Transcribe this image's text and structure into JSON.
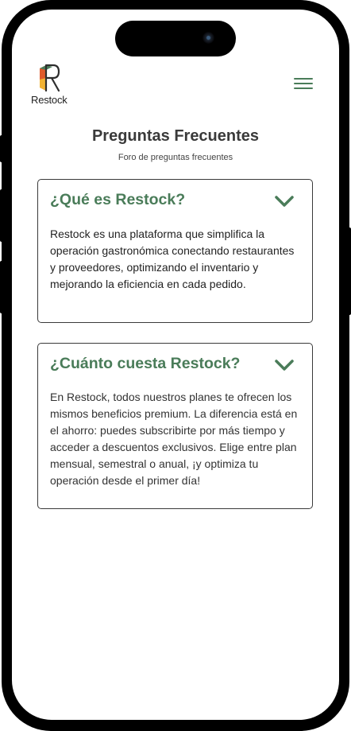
{
  "brand": {
    "name": "Restock",
    "colors": {
      "accent": "#4a7c59",
      "logo_green": "#4a7c59",
      "logo_orange": "#e05a2b",
      "logo_yellow": "#f2b233",
      "logo_dark": "#2e2e2e"
    }
  },
  "header": {
    "menu_icon": "hamburger-menu-icon"
  },
  "page": {
    "title": "Preguntas Frecuentes",
    "subtitle": "Foro de preguntas frecuentes"
  },
  "faq": [
    {
      "question": "¿Qué es Restock?",
      "answer": "Restock es una plataforma que simplifica la operación gastronómica conectando restaurantes y proveedores, optimizando el inventario y mejorando la eficiencia en cada pedido.",
      "icon": "chevron-down-icon"
    },
    {
      "question": "¿Cuánto cuesta Restock?",
      "answer": "En Restock, todos nuestros planes te ofrecen los mismos beneficios premium. La diferencia está en el ahorro: puedes subscribirte por más tiempo y acceder a descuentos exclusivos. Elige entre plan mensual, semestral o anual, ¡y optimiza tu operación desde el primer día!",
      "icon": "chevron-down-icon"
    }
  ]
}
